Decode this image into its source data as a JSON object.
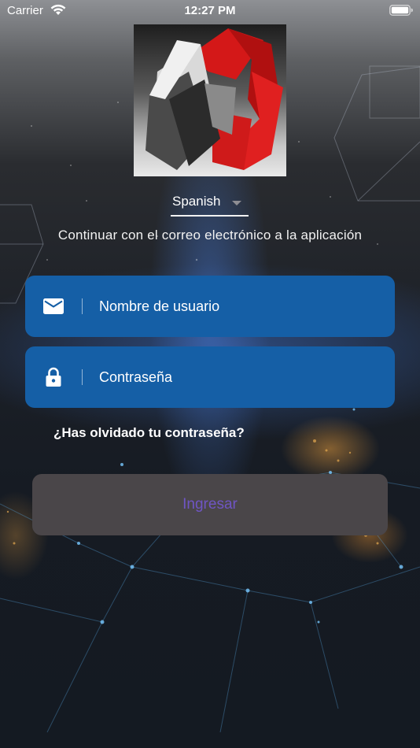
{
  "status_bar": {
    "carrier": "Carrier",
    "time": "12:27 PM"
  },
  "language": {
    "selected": "Spanish"
  },
  "subtitle": "Continuar con el correo electrónico a la aplicación",
  "form": {
    "username_placeholder": "Nombre de usuario",
    "password_placeholder": "Contraseña",
    "forgot_password": "¿Has olvidado tu contraseña?",
    "submit_label": "Ingresar"
  },
  "icons": {
    "username": "mail-icon",
    "password": "lock-icon"
  },
  "colors": {
    "field_background": "#155fa6",
    "button_background": "#4a4649",
    "button_text": "#6f55c4"
  }
}
